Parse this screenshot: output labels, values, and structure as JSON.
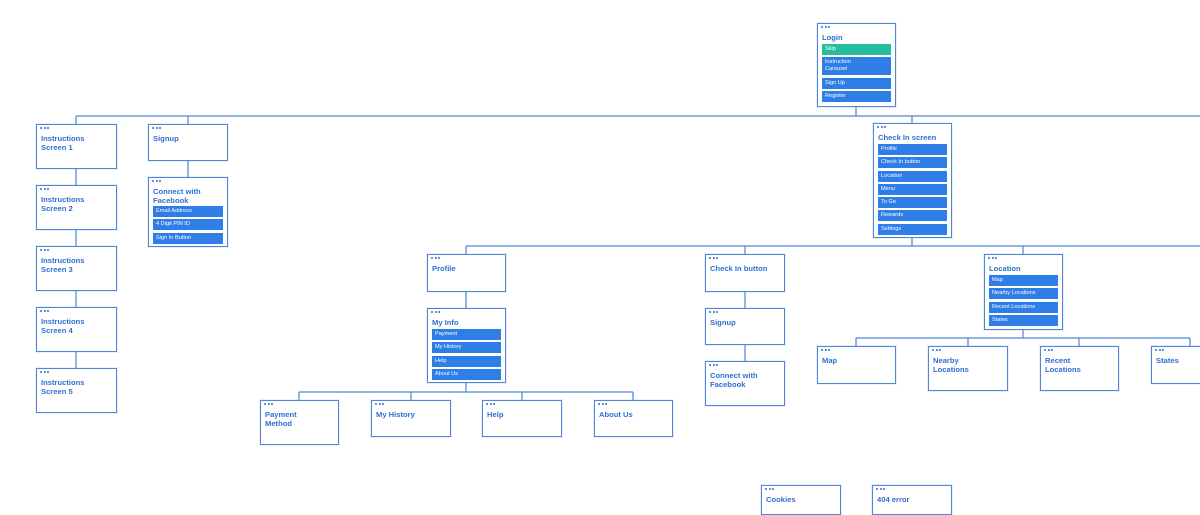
{
  "colors": {
    "primary": "#2f7de6",
    "accent": "#25bfa0",
    "line": "#4d86d6",
    "text": "#2f6fd0"
  },
  "cards": {
    "login": {
      "title": "Login",
      "items": [
        "Skip",
        "Instruction\nCarousel",
        "Sign Up",
        "Register"
      ]
    },
    "instr1": {
      "title": "Instructions\nScreen 1"
    },
    "instr2": {
      "title": "Instructions\nScreen 2"
    },
    "instr3": {
      "title": "Instructions\nScreen 3"
    },
    "instr4": {
      "title": "Instructions\nScreen 4"
    },
    "instr5": {
      "title": "Instructions\nScreen 5"
    },
    "signup": {
      "title": "Signup"
    },
    "connectfb": {
      "title": "Connect with\nFacebook",
      "items": [
        "Email Address",
        "4 Digit PIN ID",
        "Sign In Button"
      ]
    },
    "checkin": {
      "title": "Check In screen",
      "items": [
        "Profile",
        "Check In button",
        "Location",
        "Menu",
        "To Go",
        "Rewards",
        "Settings"
      ]
    },
    "profile": {
      "title": "Profile"
    },
    "checkinbutton": {
      "title": "Check In button"
    },
    "location": {
      "title": "Location",
      "items": [
        "Map",
        "Nearby Locations",
        "Recent Locations",
        "States"
      ]
    },
    "myinfo": {
      "title": "My Info",
      "items": [
        "Payment",
        "My History",
        "Help",
        "About Us"
      ]
    },
    "signup2": {
      "title": "Signup"
    },
    "connectfb2": {
      "title": "Connect with\nFacebook"
    },
    "map": {
      "title": "Map"
    },
    "nearby": {
      "title": "Nearby\nLocations"
    },
    "recent": {
      "title": "Recent\nLocations"
    },
    "states": {
      "title": "States"
    },
    "payment": {
      "title": "Payment\nMethod"
    },
    "myhistory": {
      "title": "My History"
    },
    "help": {
      "title": "Help"
    },
    "aboutus": {
      "title": "About Us"
    },
    "cookies": {
      "title": "Cookies"
    },
    "error404": {
      "title": "404 error"
    }
  }
}
